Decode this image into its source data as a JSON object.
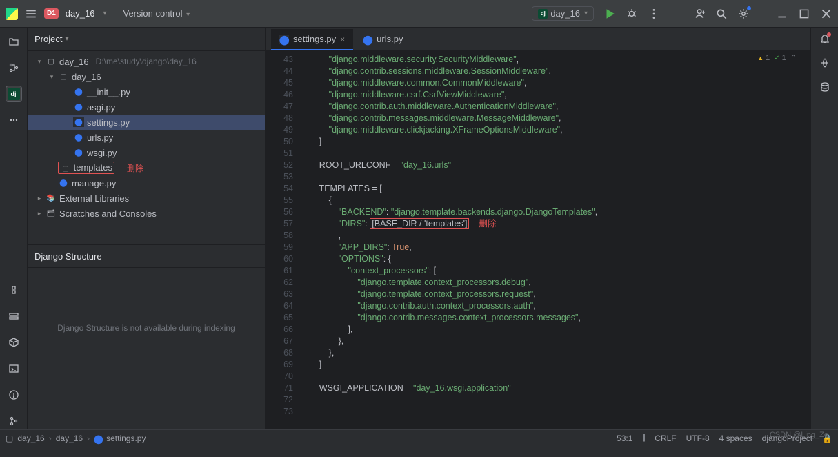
{
  "titlebar": {
    "project": "day_16",
    "vc_label": "Version control",
    "run_config": "day_16"
  },
  "project_panel": {
    "title": "Project",
    "root": "day_16",
    "root_path": "D:\\me\\study\\django\\day_16",
    "inner_dir": "day_16",
    "files": [
      "__init__.py",
      "asgi.py",
      "settings.py",
      "urls.py",
      "wsgi.py"
    ],
    "templates": "templates",
    "templates_tag": "删除",
    "manage": "manage.py",
    "external": "External Libraries",
    "scratch": "Scratches and Consoles"
  },
  "django_panel": {
    "title": "Django Structure",
    "msg": "Django Structure is not available during indexing"
  },
  "tabs": {
    "active": "settings.py",
    "other": "urls.py"
  },
  "hints": {
    "warn": "1",
    "ok": "1"
  },
  "code_lines": [
    {
      "n": 43,
      "seg": [
        {
          "c": "s-str",
          "t": "            \"django.middleware.security.SecurityMiddleware\""
        },
        {
          "c": "",
          "t": ","
        }
      ]
    },
    {
      "n": 44,
      "seg": [
        {
          "c": "s-str",
          "t": "            \"django.contrib.sessions.middleware.SessionMiddleware\""
        },
        {
          "c": "",
          "t": ","
        }
      ]
    },
    {
      "n": 45,
      "seg": [
        {
          "c": "s-str",
          "t": "            \"django.middleware.common.CommonMiddleware\""
        },
        {
          "c": "",
          "t": ","
        }
      ]
    },
    {
      "n": 46,
      "seg": [
        {
          "c": "s-str",
          "t": "            \"django.middleware.csrf.CsrfViewMiddleware\""
        },
        {
          "c": "",
          "t": ","
        }
      ]
    },
    {
      "n": 47,
      "seg": [
        {
          "c": "s-str",
          "t": "            \"django.contrib.auth.middleware.AuthenticationMiddleware\""
        },
        {
          "c": "",
          "t": ","
        }
      ]
    },
    {
      "n": 48,
      "seg": [
        {
          "c": "s-str",
          "t": "            \"django.contrib.messages.middleware.MessageMiddleware\""
        },
        {
          "c": "",
          "t": ","
        }
      ]
    },
    {
      "n": 49,
      "seg": [
        {
          "c": "s-str",
          "t": "            \"django.middleware.clickjacking.XFrameOptionsMiddleware\""
        },
        {
          "c": "",
          "t": ","
        }
      ]
    },
    {
      "n": 50,
      "seg": [
        {
          "c": "",
          "t": "        ]"
        }
      ]
    },
    {
      "n": 51,
      "seg": [
        {
          "c": "",
          "t": ""
        }
      ]
    },
    {
      "n": 52,
      "seg": [
        {
          "c": "",
          "t": "        ROOT_URLCONF = "
        },
        {
          "c": "s-str",
          "t": "\"day_16.urls\""
        }
      ]
    },
    {
      "n": 53,
      "seg": [
        {
          "c": "",
          "t": ""
        }
      ]
    },
    {
      "n": 54,
      "seg": [
        {
          "c": "",
          "t": "        TEMPLATES = ["
        }
      ]
    },
    {
      "n": 55,
      "seg": [
        {
          "c": "",
          "t": "            {"
        }
      ]
    },
    {
      "n": 56,
      "seg": [
        {
          "c": "",
          "t": "                "
        },
        {
          "c": "s-key",
          "t": "\"BACKEND\""
        },
        {
          "c": "",
          "t": ": "
        },
        {
          "c": "s-str",
          "t": "\"django.template.backends.django.DjangoTemplates\""
        },
        {
          "c": "",
          "t": ","
        }
      ]
    },
    {
      "n": 57,
      "seg": [
        {
          "c": "",
          "t": "                "
        },
        {
          "c": "s-key",
          "t": "\"DIRS\""
        },
        {
          "c": "",
          "t": ": "
        }
      ],
      "boxed": "[BASE_DIR / 'templates']",
      "tag": "删除"
    },
    {
      "n": 58,
      "seg": [
        {
          "c": "",
          "t": "                ,"
        }
      ]
    },
    {
      "n": 59,
      "seg": [
        {
          "c": "",
          "t": "                "
        },
        {
          "c": "s-key",
          "t": "\"APP_DIRS\""
        },
        {
          "c": "",
          "t": ": "
        },
        {
          "c": "s-bool",
          "t": "True"
        },
        {
          "c": "",
          "t": ","
        }
      ]
    },
    {
      "n": 60,
      "seg": [
        {
          "c": "",
          "t": "                "
        },
        {
          "c": "s-key",
          "t": "\"OPTIONS\""
        },
        {
          "c": "",
          "t": ": {"
        }
      ]
    },
    {
      "n": 61,
      "seg": [
        {
          "c": "",
          "t": "                    "
        },
        {
          "c": "s-key",
          "t": "\"context_processors\""
        },
        {
          "c": "",
          "t": ": ["
        }
      ]
    },
    {
      "n": 62,
      "seg": [
        {
          "c": "s-str",
          "t": "                        \"django.template.context_processors.debug\""
        },
        {
          "c": "",
          "t": ","
        }
      ]
    },
    {
      "n": 63,
      "seg": [
        {
          "c": "s-str",
          "t": "                        \"django.template.context_processors.request\""
        },
        {
          "c": "",
          "t": ","
        }
      ]
    },
    {
      "n": 64,
      "seg": [
        {
          "c": "s-str",
          "t": "                        \"django.contrib.auth.context_processors.auth\""
        },
        {
          "c": "",
          "t": ","
        }
      ]
    },
    {
      "n": 65,
      "seg": [
        {
          "c": "s-str",
          "t": "                        \"django.contrib.messages.context_processors.messages\""
        },
        {
          "c": "",
          "t": ","
        }
      ]
    },
    {
      "n": 66,
      "seg": [
        {
          "c": "",
          "t": "                    ],"
        }
      ]
    },
    {
      "n": 67,
      "seg": [
        {
          "c": "",
          "t": "                },"
        }
      ]
    },
    {
      "n": 68,
      "seg": [
        {
          "c": "",
          "t": "            },"
        }
      ]
    },
    {
      "n": 69,
      "seg": [
        {
          "c": "",
          "t": "        ]"
        }
      ]
    },
    {
      "n": 70,
      "seg": [
        {
          "c": "",
          "t": ""
        }
      ]
    },
    {
      "n": 71,
      "seg": [
        {
          "c": "",
          "t": "        WSGI_APPLICATION = "
        },
        {
          "c": "s-str",
          "t": "\"day_16.wsgi.application\""
        }
      ]
    },
    {
      "n": 72,
      "seg": [
        {
          "c": "",
          "t": ""
        }
      ]
    },
    {
      "n": 73,
      "seg": [
        {
          "c": "",
          "t": ""
        }
      ]
    }
  ],
  "status": {
    "bc": [
      "day_16",
      "day_16",
      "settings.py"
    ],
    "pos": "53:1",
    "sep": "CRLF",
    "enc": "UTF-8",
    "indent": "4 spaces",
    "project": "djangoProject"
  },
  "watermark": "CSDN @Ling_Ze"
}
